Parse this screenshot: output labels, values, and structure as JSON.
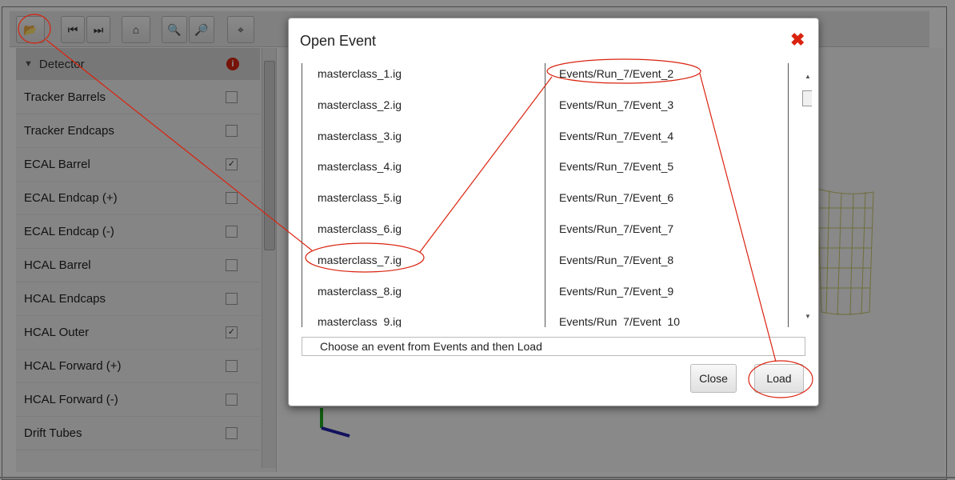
{
  "dialog": {
    "title": "Open Event",
    "files": [
      "masterclass_1.ig",
      "masterclass_2.ig",
      "masterclass_3.ig",
      "masterclass_4.ig",
      "masterclass_5.ig",
      "masterclass_6.ig",
      "masterclass_7.ig",
      "masterclass_8.ig",
      "masterclass_9.ig"
    ],
    "events": [
      "Events/Run_7/Event_2",
      "Events/Run_7/Event_3",
      "Events/Run_7/Event_4",
      "Events/Run_7/Event_5",
      "Events/Run_7/Event_6",
      "Events/Run_7/Event_7",
      "Events/Run_7/Event_8",
      "Events/Run_7/Event_9",
      "Events/Run_7/Event_10"
    ],
    "status_text": "Choose an event from Events and then Load",
    "close_label": "Close",
    "load_label": "Load"
  },
  "sidebar": {
    "header": "Detector",
    "items": [
      {
        "label": "Tracker Barrels",
        "checked": false
      },
      {
        "label": "Tracker Endcaps",
        "checked": false
      },
      {
        "label": "ECAL Barrel",
        "checked": true
      },
      {
        "label": "ECAL Endcap (+)",
        "checked": false
      },
      {
        "label": "ECAL Endcap (-)",
        "checked": false
      },
      {
        "label": "HCAL Barrel",
        "checked": false
      },
      {
        "label": "HCAL Endcaps",
        "checked": false
      },
      {
        "label": "HCAL Outer",
        "checked": true
      },
      {
        "label": "HCAL Forward (+)",
        "checked": false
      },
      {
        "label": "HCAL Forward (-)",
        "checked": false
      },
      {
        "label": "Drift Tubes",
        "checked": false
      }
    ]
  },
  "icons": {
    "open": "folder-open-icon",
    "first": "step-backward-icon",
    "last": "step-forward-icon",
    "home": "home-icon",
    "zoom_in": "zoom-in-icon",
    "zoom_out": "zoom-out-icon",
    "axes": "axes-icon",
    "close": "close-icon",
    "alert": "alert-icon"
  },
  "colors": {
    "annotation": "#d9230f",
    "close_x": "#d9230f",
    "overlay": "rgba(0,0,0,0.45)"
  }
}
